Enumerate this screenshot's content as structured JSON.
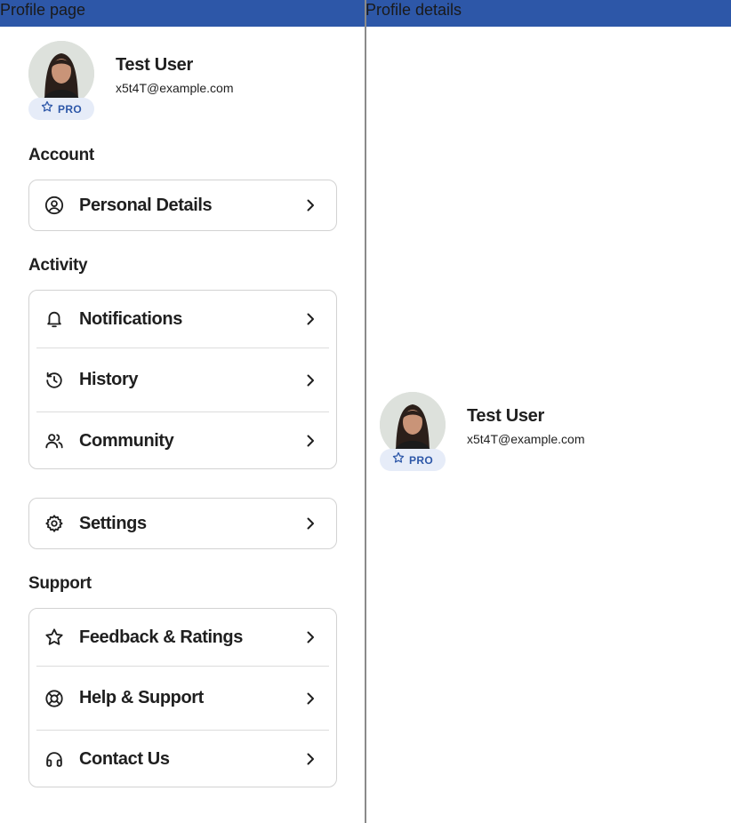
{
  "topbar": {
    "left_title": "Profile page",
    "right_title": "Profile details",
    "color": "#2d57a8"
  },
  "profile": {
    "name": "Test User",
    "email": "x5t4T@example.com",
    "badge": "PRO",
    "badge_icon": "star-icon"
  },
  "sections": {
    "account": {
      "title": "Account",
      "items": [
        {
          "label": "Personal Details",
          "icon": "user-circle-icon"
        }
      ]
    },
    "activity": {
      "title": "Activity",
      "items": [
        {
          "label": "Notifications",
          "icon": "bell-icon"
        },
        {
          "label": "History",
          "icon": "history-icon"
        },
        {
          "label": "Community",
          "icon": "users-icon"
        }
      ]
    },
    "settings": {
      "items": [
        {
          "label": "Settings",
          "icon": "gear-icon"
        }
      ]
    },
    "support": {
      "title": "Support",
      "items": [
        {
          "label": "Feedback & Ratings",
          "icon": "star-icon"
        },
        {
          "label": "Help & Support",
          "icon": "lifebuoy-icon"
        },
        {
          "label": "Contact Us",
          "icon": "headphones-icon"
        }
      ]
    }
  },
  "details": {
    "name": "Test User",
    "email": "x5t4T@example.com",
    "badge": "PRO"
  }
}
